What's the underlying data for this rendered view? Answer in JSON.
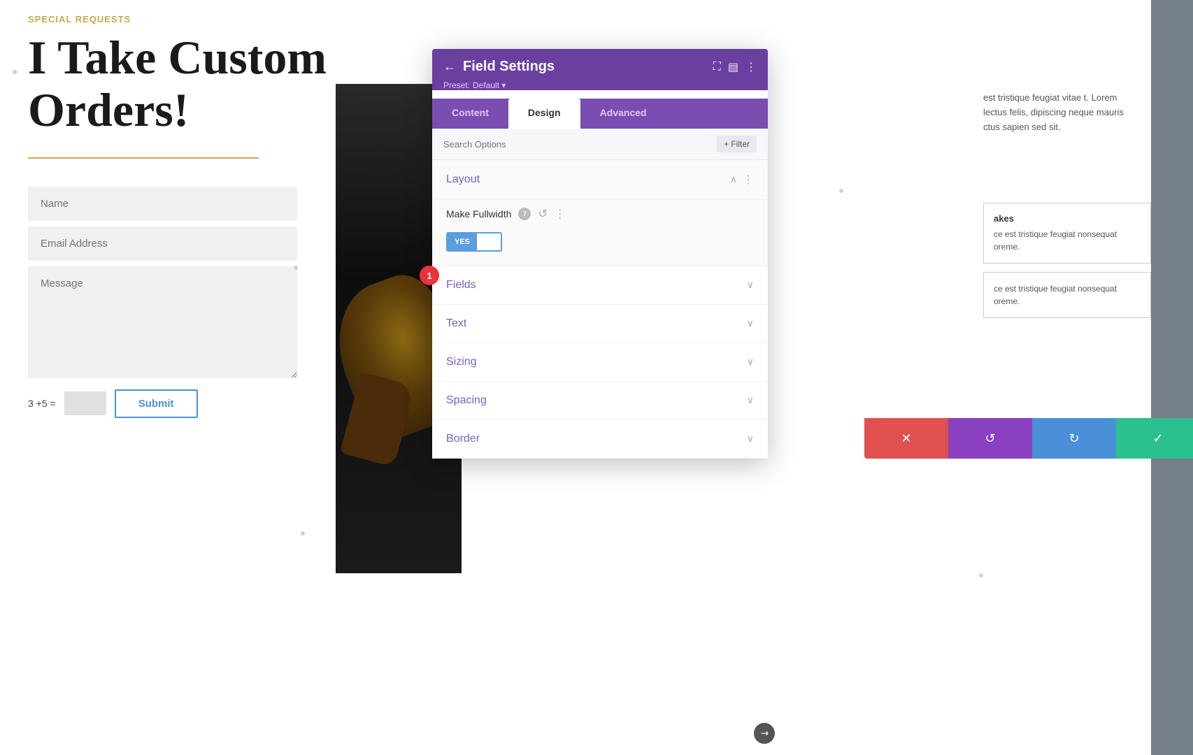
{
  "page": {
    "special_requests_label": "SPECIAL REQUESTS",
    "main_heading": "I Take Custom Orders!",
    "divider_color": "#c9a84c"
  },
  "form": {
    "name_placeholder": "Name",
    "email_placeholder": "Email Address",
    "message_placeholder": "Message",
    "captcha_text": "3 +5 =",
    "submit_label": "Submit"
  },
  "right_text": {
    "paragraph1": "est tristique feugiat vitae t. Lorem lectus felis, dipiscing neque mauris ctus sapien sed sit.",
    "box1_title": "akes",
    "box1_text": "ce est tristique feugiat nonsequat oreme.",
    "box2_text": "ce est tristique feugiat nonsequat oreme."
  },
  "panel": {
    "title": "Field Settings",
    "preset_label": "Preset: Default",
    "preset_arrow": "▾",
    "tabs": [
      {
        "id": "content",
        "label": "Content",
        "active": false
      },
      {
        "id": "design",
        "label": "Design",
        "active": true
      },
      {
        "id": "advanced",
        "label": "Advanced",
        "active": false
      }
    ],
    "search_placeholder": "Search Options",
    "filter_label": "+ Filter",
    "sections": [
      {
        "id": "layout",
        "title": "Layout",
        "expanded": true,
        "options": [
          {
            "id": "make_fullwidth",
            "label": "Make Fullwidth",
            "toggle_yes": "YES",
            "toggle_no": "",
            "value": "yes"
          }
        ]
      },
      {
        "id": "fields",
        "title": "Fields",
        "expanded": false
      },
      {
        "id": "text",
        "title": "Text",
        "expanded": false
      },
      {
        "id": "sizing",
        "title": "Sizing",
        "expanded": false
      },
      {
        "id": "spacing",
        "title": "Spacing",
        "expanded": false
      },
      {
        "id": "border",
        "title": "Border",
        "expanded": false
      }
    ],
    "badge_number": "1",
    "bottom_bar": {
      "cancel_icon": "✕",
      "undo_icon": "↺",
      "redo_icon": "↻",
      "confirm_icon": "✓"
    }
  },
  "icons": {
    "back": "←",
    "fullscreen": "⛶",
    "sidebar": "▤",
    "more": "⋮",
    "chevron_up": "∧",
    "chevron_down": "∨",
    "help": "?",
    "reset": "↺",
    "resize": "↗"
  }
}
